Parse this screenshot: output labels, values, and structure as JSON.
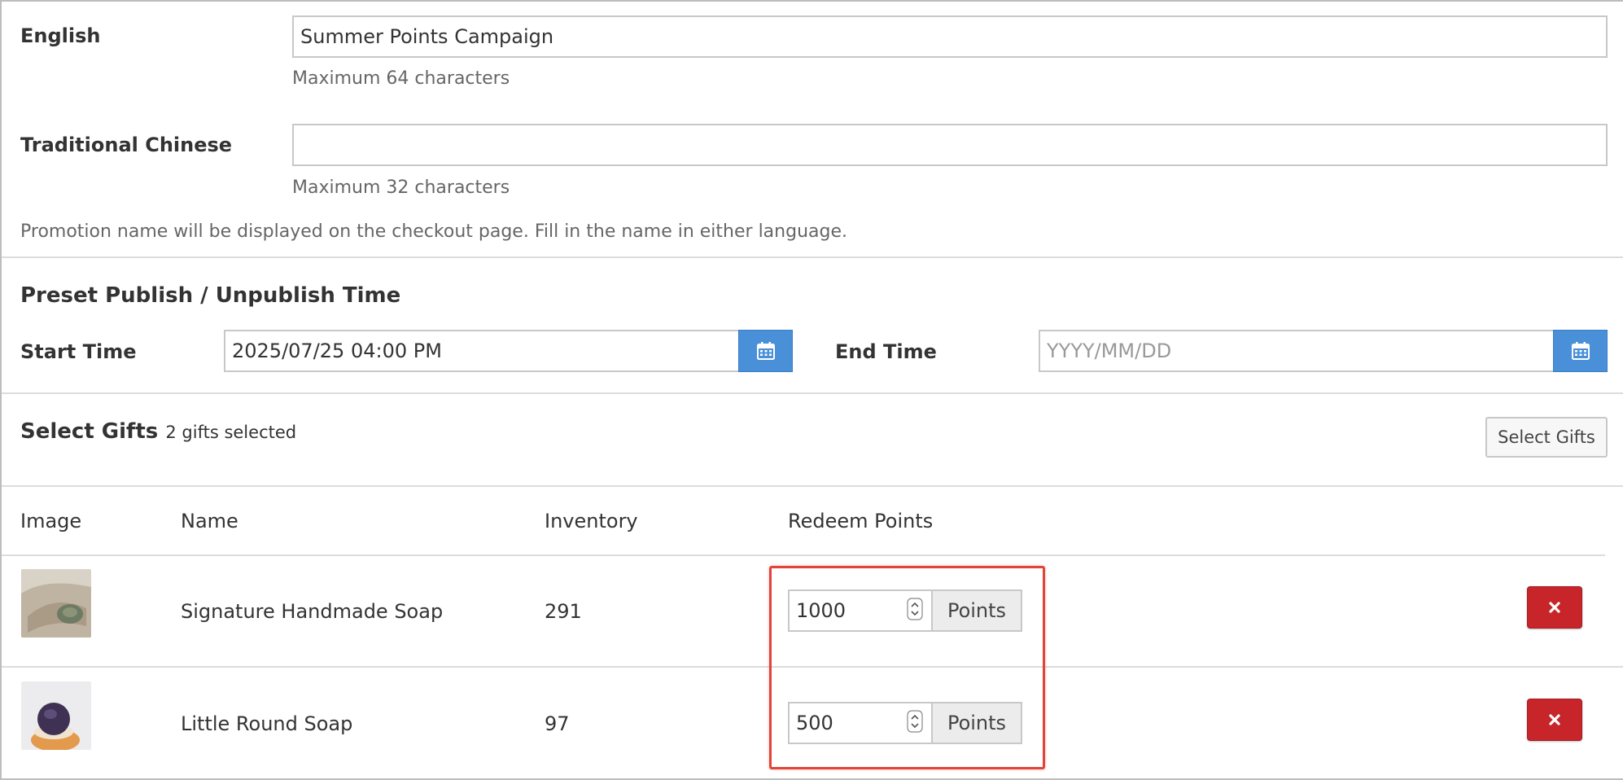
{
  "name_section": {
    "english": {
      "label": "English",
      "value": "Summer Points Campaign",
      "help": "Maximum 64 characters"
    },
    "traditional_chinese": {
      "label": "Traditional Chinese",
      "value": "",
      "help": "Maximum 32 characters"
    },
    "note": "Promotion name will be displayed on the checkout page. Fill in the name in either language."
  },
  "schedule": {
    "title": "Preset Publish / Unpublish Time",
    "start_label": "Start Time",
    "start_value": "2025/07/25 04:00 PM",
    "end_label": "End Time",
    "end_placeholder": "YYYY/MM/DD",
    "calendar_icon": "calendar-icon"
  },
  "gifts": {
    "title": "Select Gifts",
    "selected_count": "2 gifts selected",
    "select_button": "Select Gifts",
    "columns": [
      "Image",
      "Name",
      "Inventory",
      "Redeem Points"
    ],
    "rows": [
      {
        "name": "Signature Handmade Soap",
        "inventory": "291",
        "points": "1000",
        "unit": "Points"
      },
      {
        "name": "Little Round Soap",
        "inventory": "97",
        "points": "500",
        "unit": "Points"
      }
    ],
    "delete_icon": "close-icon"
  },
  "colors": {
    "calendar_button": "#4a90d9",
    "delete_button": "#c8252b",
    "highlight": "#e0443a"
  }
}
